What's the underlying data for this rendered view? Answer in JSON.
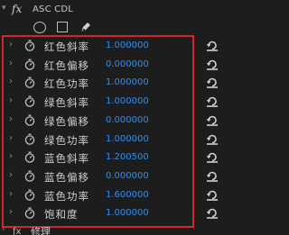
{
  "effect": {
    "fx_badge": "fx",
    "name": "ASC CDL"
  },
  "mask_tools": [
    "ellipse-mask-icon",
    "rectangle-mask-icon",
    "pen-mask-icon"
  ],
  "params": [
    {
      "label": "红色斜率",
      "value": "1.000000"
    },
    {
      "label": "红色偏移",
      "value": "0.000000"
    },
    {
      "label": "红色功率",
      "value": "1.000000"
    },
    {
      "label": "绿色斜率",
      "value": "1.000000"
    },
    {
      "label": "绿色偏移",
      "value": "0.000000"
    },
    {
      "label": "绿色功率",
      "value": "1.000000"
    },
    {
      "label": "蓝色斜率",
      "value": "1.200500"
    },
    {
      "label": "蓝色偏移",
      "value": "0.000000"
    },
    {
      "label": "蓝色功率",
      "value": "1.600000"
    },
    {
      "label": "饱和度",
      "value": "1.000000"
    }
  ],
  "next_effect": {
    "label": "修理"
  },
  "colors": {
    "value": "#2f8ff1",
    "highlight_frame": "#d6252a",
    "background": "#1d1d1d"
  }
}
